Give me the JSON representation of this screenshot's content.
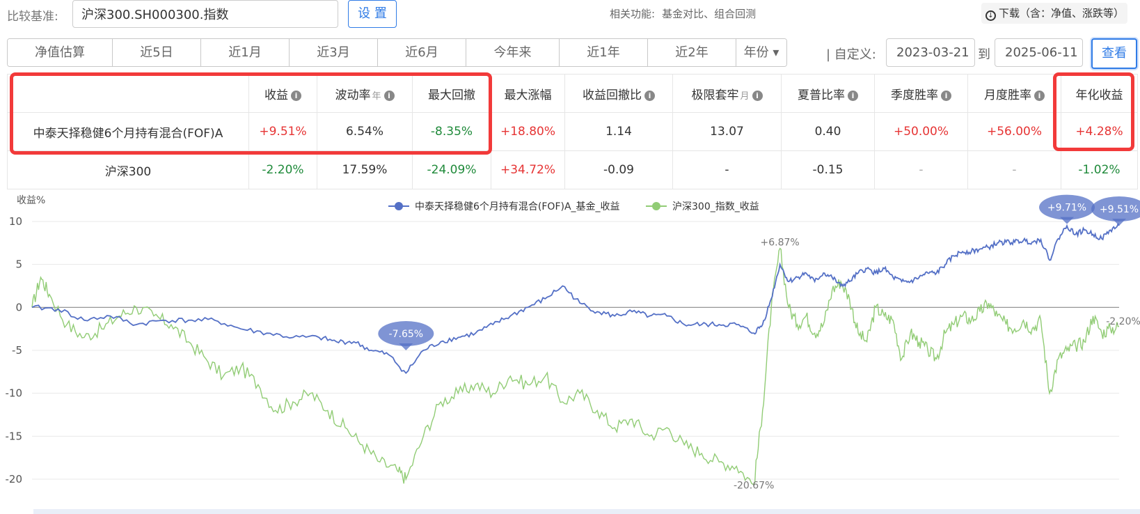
{
  "header": {
    "benchmark_label": "比较基准:",
    "benchmark_value": "沪深300.SH000300.指数",
    "set_button": "设 置",
    "related_label": "相关功能:",
    "related_links": [
      "基金对比、",
      "组合回测"
    ],
    "download_label": "下载（含：净值、涨跌等）"
  },
  "period_tabs": [
    "净值估算",
    "近5日",
    "近1月",
    "近3月",
    "近6月",
    "今年来",
    "近1年",
    "近2年",
    "年份 ▾"
  ],
  "custom_range": {
    "label": "| 自定义:",
    "start": "2023-03-21",
    "to_label": "到",
    "end": "2025-06-11",
    "view_button": "查看"
  },
  "stats_table": {
    "headers": [
      "",
      "收益",
      "波动率",
      "最大回撤",
      "最大涨幅",
      "收益回撤比",
      "极限套牢",
      "夏普比率",
      "季度胜率",
      "月度胜率",
      "年化收益"
    ],
    "header_suffixes": {
      "volatility": "年",
      "stuck": "月"
    },
    "rows": [
      {
        "name": "中泰天择稳健6个月持有混合(FOF)A",
        "values": [
          "+9.51%",
          "6.54%",
          "-8.35%",
          "+18.80%",
          "1.14",
          "13.07",
          "0.40",
          "+50.00%",
          "+56.00%",
          "+4.28%"
        ]
      },
      {
        "name": "沪深300",
        "values": [
          "-2.20%",
          "17.59%",
          "-24.09%",
          "+34.72%",
          "-0.09",
          "-",
          "-0.15",
          "-",
          "-",
          "-1.02%"
        ]
      }
    ]
  },
  "chart_data": {
    "type": "line",
    "ylabel": "收益%",
    "ylim": [
      -20,
      10
    ],
    "yticks": [
      10,
      5,
      0,
      -5,
      -10,
      -15,
      -20
    ],
    "grid": true,
    "legend_position": "top-center",
    "colors": {
      "fund": "#5470c6",
      "index": "#91cc75"
    },
    "series": [
      {
        "name": "中泰天择稳健6个月持有混合(FOF)A_基金_收益",
        "key_points": [
          [
            0,
            0
          ],
          [
            3,
            -0.2
          ],
          [
            6,
            -1.5
          ],
          [
            9,
            -1
          ],
          [
            12,
            -2
          ],
          [
            15,
            -1.5
          ],
          [
            18,
            -1.5
          ],
          [
            21,
            -1.5
          ],
          [
            24,
            -2.5
          ],
          [
            27,
            -3
          ],
          [
            30,
            -3.5
          ],
          [
            33,
            -3.5
          ],
          [
            35,
            -4
          ],
          [
            37,
            -4
          ],
          [
            39,
            -5
          ],
          [
            41,
            -5.5
          ],
          [
            43,
            -7.65
          ],
          [
            45,
            -5
          ],
          [
            47,
            -4
          ],
          [
            49,
            -3.5
          ],
          [
            51,
            -3
          ],
          [
            53,
            -2
          ],
          [
            55,
            -1
          ],
          [
            57,
            0
          ],
          [
            59,
            1
          ],
          [
            61,
            2.5
          ],
          [
            63,
            0.5
          ],
          [
            65,
            -0.5
          ],
          [
            67,
            -1
          ],
          [
            69,
            -0.5
          ],
          [
            71,
            -1
          ],
          [
            73,
            -1
          ],
          [
            75,
            -2
          ],
          [
            77,
            -2
          ],
          [
            79,
            -2
          ],
          [
            81,
            -2
          ],
          [
            83,
            -3
          ],
          [
            84,
            -2
          ],
          [
            85,
            1
          ],
          [
            86,
            5
          ],
          [
            87,
            3
          ],
          [
            88,
            3.5
          ],
          [
            89,
            4
          ],
          [
            90,
            3
          ],
          [
            91,
            4
          ],
          [
            92,
            3.5
          ],
          [
            93,
            2.5
          ],
          [
            94,
            3
          ],
          [
            95,
            4
          ],
          [
            96,
            4.5
          ],
          [
            97,
            4
          ],
          [
            98,
            4.5
          ],
          [
            99,
            3.5
          ],
          [
            100,
            3
          ],
          [
            101,
            3
          ],
          [
            102,
            3.5
          ],
          [
            103,
            4
          ],
          [
            104,
            4
          ],
          [
            105,
            5
          ],
          [
            106,
            6
          ],
          [
            107,
            6.5
          ],
          [
            108,
            6.5
          ],
          [
            109,
            6.8
          ],
          [
            110,
            7
          ],
          [
            111,
            7.5
          ],
          [
            112,
            7.6
          ],
          [
            113,
            7.6
          ],
          [
            114,
            7.8
          ],
          [
            115,
            7.6
          ],
          [
            116,
            7.9
          ],
          [
            117,
            5.5
          ],
          [
            118,
            8
          ],
          [
            119,
            9.5
          ],
          [
            120,
            8.5
          ],
          [
            121,
            9
          ],
          [
            122,
            8.5
          ],
          [
            123,
            8
          ],
          [
            124,
            9
          ],
          [
            125,
            9.51
          ]
        ]
      },
      {
        "name": "沪深300_指数_收益",
        "key_points": [
          [
            0,
            0
          ],
          [
            1,
            3.5
          ],
          [
            2,
            1.5
          ],
          [
            4,
            -2
          ],
          [
            6,
            -3.5
          ],
          [
            8,
            -2.5
          ],
          [
            10,
            -1
          ],
          [
            12,
            0
          ],
          [
            14,
            -1
          ],
          [
            16,
            -2
          ],
          [
            18,
            -4
          ],
          [
            20,
            -6
          ],
          [
            22,
            -8
          ],
          [
            24,
            -7
          ],
          [
            26,
            -9
          ],
          [
            28,
            -12
          ],
          [
            30,
            -11
          ],
          [
            32,
            -10
          ],
          [
            34,
            -12
          ],
          [
            36,
            -14
          ],
          [
            38,
            -16
          ],
          [
            40,
            -18
          ],
          [
            42,
            -19
          ],
          [
            43,
            -20
          ],
          [
            45,
            -15
          ],
          [
            47,
            -11
          ],
          [
            49,
            -10
          ],
          [
            51,
            -9
          ],
          [
            53,
            -10
          ],
          [
            55,
            -8
          ],
          [
            57,
            -9
          ],
          [
            59,
            -8
          ],
          [
            61,
            -11
          ],
          [
            63,
            -10
          ],
          [
            65,
            -12
          ],
          [
            67,
            -14
          ],
          [
            69,
            -13
          ],
          [
            71,
            -15
          ],
          [
            73,
            -14
          ],
          [
            75,
            -16
          ],
          [
            77,
            -17
          ],
          [
            79,
            -18
          ],
          [
            81,
            -18.5
          ],
          [
            83,
            -20.67
          ],
          [
            84,
            -12
          ],
          [
            85,
            0
          ],
          [
            86,
            6.87
          ],
          [
            87,
            0
          ],
          [
            88,
            -2
          ],
          [
            89,
            -1
          ],
          [
            90,
            -3
          ],
          [
            91,
            -2
          ],
          [
            92,
            2
          ],
          [
            93,
            3
          ],
          [
            94,
            1
          ],
          [
            95,
            -3
          ],
          [
            96,
            -4
          ],
          [
            97,
            0
          ],
          [
            98,
            -1
          ],
          [
            99,
            -1.5
          ],
          [
            100,
            -6
          ],
          [
            101,
            -3
          ],
          [
            102,
            -4
          ],
          [
            103,
            -5
          ],
          [
            104,
            -6
          ],
          [
            105,
            -3
          ],
          [
            106,
            -2
          ],
          [
            107,
            -1
          ],
          [
            108,
            -1.5
          ],
          [
            109,
            -0.5
          ],
          [
            110,
            0.5
          ],
          [
            111,
            -1
          ],
          [
            112,
            -2
          ],
          [
            113,
            -2.5
          ],
          [
            114,
            -1.5
          ],
          [
            115,
            -2.5
          ],
          [
            116,
            -1.5
          ],
          [
            117,
            -10
          ],
          [
            118,
            -6
          ],
          [
            119,
            -5
          ],
          [
            120,
            -4.5
          ],
          [
            121,
            -4
          ],
          [
            122,
            -1
          ],
          [
            123,
            -3
          ],
          [
            124,
            -2.5
          ],
          [
            125,
            -2.2
          ]
        ]
      }
    ],
    "annotations": {
      "fund_max": "+9.71%",
      "fund_min": "-7.65%",
      "fund_last": "+9.51%",
      "index_max": "+6.87%",
      "index_min": "-20.67%",
      "index_last": "-2.20%"
    }
  }
}
